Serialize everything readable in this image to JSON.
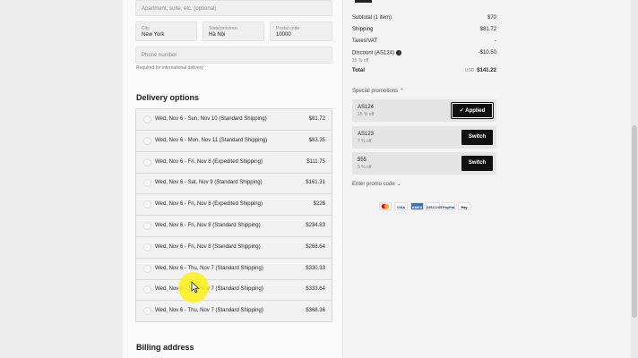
{
  "address": {
    "apartment_placeholder": "Apartment, suite, etc. (optional)",
    "city_label": "City",
    "city_value": "New York",
    "state_label": "State/province",
    "state_value": "Hà Nội",
    "postal_label": "Postal code",
    "postal_value": "10000",
    "phone_placeholder": "Phone number",
    "phone_hint": "Required for international delivery"
  },
  "delivery": {
    "title": "Delivery options",
    "options": [
      {
        "name": "Wed, Nov 6 - Sun, Nov 10 (Standard Shipping)",
        "price": "$81.72"
      },
      {
        "name": "Wed, Nov 6 - Mon, Nov 11 (Standard Shipping)",
        "price": "$83.35"
      },
      {
        "name": "Wed, Nov 6 - Fri, Nov 8 (Expedited Shipping)",
        "price": "$111.75"
      },
      {
        "name": "Wed, Nov 6 - Sat, Nov 9 (Standard Shipping)",
        "price": "$161.31"
      },
      {
        "name": "Wed, Nov 6 - Fri, Nov 8 (Expedited Shipping)",
        "price": "$226"
      },
      {
        "name": "Wed, Nov 6 - Fri, Nov 8 (Standard Shipping)",
        "price": "$234.83"
      },
      {
        "name": "Wed, Nov 6 - Fri, Nov 8 (Standard Shipping)",
        "price": "$268.64"
      },
      {
        "name": "Wed, Nov 6 - Thu, Nov 7 (Standard Shipping)",
        "price": "$330.33"
      },
      {
        "name": "Wed, Nov 6 - Thu, Nov 7 (Standard Shipping)",
        "price": "$333.64"
      },
      {
        "name": "Wed, Nov 6 - Thu, Nov 7 (Standard Shipping)",
        "price": "$368.36"
      }
    ]
  },
  "billing": {
    "title": "Billing address"
  },
  "summary": {
    "subtotal_label": "Subtotal (1 item)",
    "subtotal_value": "$70",
    "shipping_label": "Shipping",
    "shipping_value": "$81.72",
    "taxes_label": "Taxes/VAT",
    "taxes_value": "-",
    "discount_label": "Discount (AS124)",
    "discount_value": "-$10.50",
    "discount_note": "15 % off",
    "total_label": "Total",
    "total_currency": "USD",
    "total_value": "$141.22"
  },
  "promotions": {
    "toggle_label": "Special promotions",
    "cards": [
      {
        "code": "AS124",
        "off": "15 % off",
        "button": "Applied"
      },
      {
        "code": "AS123",
        "off": "7 % off",
        "button": "Switch"
      },
      {
        "code": "555",
        "off": "5 % off",
        "button": "Switch"
      }
    ],
    "enter_code_label": "Enter promo code"
  },
  "payment_methods": [
    {
      "name": "mastercard-icon",
      "label": "",
      "bg": "#ffffff",
      "color": "#eb001b"
    },
    {
      "name": "visa-icon",
      "label": "VISA",
      "bg": "#ffffff",
      "color": "#1a1f71"
    },
    {
      "name": "amex-icon",
      "label": "AMEX",
      "bg": "#2e77bc",
      "color": "#ffffff"
    },
    {
      "name": "discover-icon",
      "label": "DISCOVER",
      "bg": "#ffffff",
      "color": "#333333"
    },
    {
      "name": "paypal-icon",
      "label": "PayPal",
      "bg": "#ffffff",
      "color": "#003087"
    },
    {
      "name": "applepay-icon",
      "label": "Pay",
      "bg": "#ffffff",
      "color": "#000000"
    }
  ]
}
